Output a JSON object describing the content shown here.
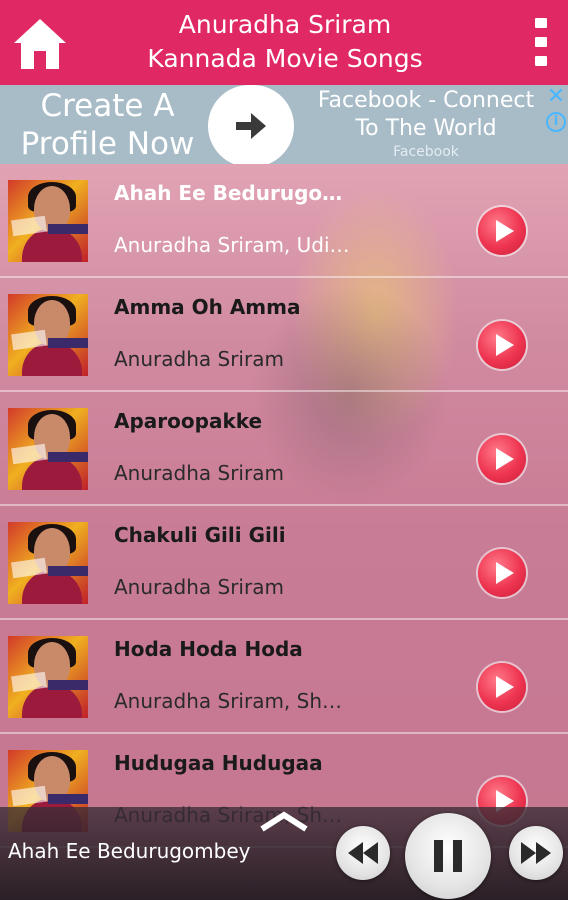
{
  "header": {
    "title_line1": "Anuradha Sriram",
    "title_line2": "Kannada Movie Songs",
    "accent": "#e02865"
  },
  "ad": {
    "left_line1": "Create A",
    "left_line2": "Profile Now",
    "right_line1": "Facebook - Connect",
    "right_line2": "To The World",
    "source": "Facebook",
    "close_glyph": "✕",
    "info_glyph": "i"
  },
  "songs": [
    {
      "title": "Ahah Ee Bedurugombey",
      "artist": "Anuradha Sriram, Udit Narayan"
    },
    {
      "title": "Amma Oh Amma",
      "artist": "Anuradha Sriram"
    },
    {
      "title": "Aparoopakke",
      "artist": "Anuradha Sriram"
    },
    {
      "title": "Chakuli Gili Gili",
      "artist": "Anuradha Sriram"
    },
    {
      "title": "Hoda Hoda Hoda",
      "artist": "Anuradha Sriram, Shankar Mahadevan"
    },
    {
      "title": "Hudugaa Hudugaa",
      "artist": "Anuradha Sriram, Shankar Mahadevan"
    }
  ],
  "player": {
    "now_playing": "Ahah Ee Bedurugombey",
    "state": "playing"
  },
  "icons": {
    "home": "home-icon",
    "overflow": "more-vert-icon",
    "arrow": "arrow-right-icon",
    "play": "play-icon",
    "rewind": "rewind-icon",
    "pause": "pause-icon",
    "forward": "fast-forward-icon",
    "expand": "chevron-up-icon"
  }
}
